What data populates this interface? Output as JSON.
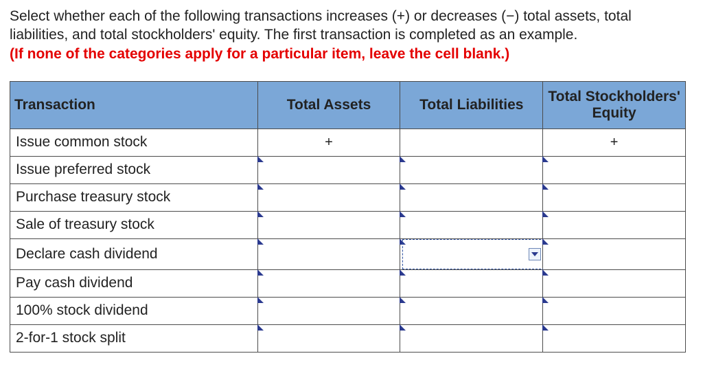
{
  "instructions": {
    "line1": "Select whether each of the following transactions increases (+) or decreases (−) total assets, total liabilities, and total stockholders' equity. The first transaction is completed as an example.",
    "warn": "(If none of the categories apply for a particular item, leave the cell blank.)"
  },
  "headers": {
    "c0": "Transaction",
    "c1": "Total Assets",
    "c2": "Total Liabilities",
    "c3": "Total Stockholders' Equity"
  },
  "rows": [
    {
      "label": "Issue common stock",
      "assets": "+",
      "liab": "",
      "equity": "+",
      "example": true
    },
    {
      "label": "Issue preferred stock",
      "assets": "",
      "liab": "",
      "equity": ""
    },
    {
      "label": "Purchase treasury stock",
      "assets": "",
      "liab": "",
      "equity": ""
    },
    {
      "label": "Sale of treasury stock",
      "assets": "",
      "liab": "",
      "equity": ""
    },
    {
      "label": "Declare cash dividend",
      "assets": "",
      "liab": "",
      "equity": "",
      "activeCol": "liab"
    },
    {
      "label": "Pay cash dividend",
      "assets": "",
      "liab": "",
      "equity": ""
    },
    {
      "label": "100% stock dividend",
      "assets": "",
      "liab": "",
      "equity": ""
    },
    {
      "label": "2-for-1 stock split",
      "assets": "",
      "liab": "",
      "equity": ""
    }
  ]
}
